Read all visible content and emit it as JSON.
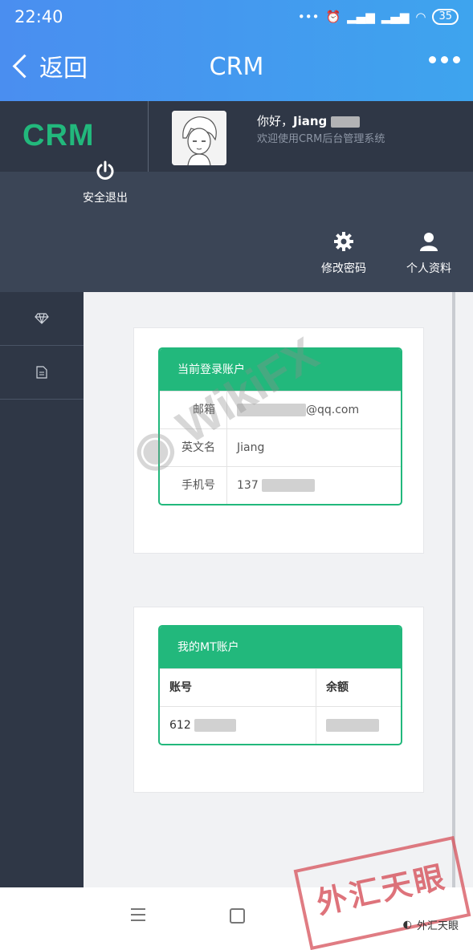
{
  "status": {
    "time": "22:40",
    "battery": "35"
  },
  "titlebar": {
    "back_label": "返回",
    "title": "CRM"
  },
  "header": {
    "logo": "CRM",
    "greeting": "你好，",
    "username": "Jiang",
    "welcome": "欢迎使用CRM后台管理系统",
    "logout_label": "安全退出",
    "change_password_label": "修改密码",
    "profile_label": "个人资料"
  },
  "account": {
    "title": "当前登录账户",
    "rows": [
      {
        "label": "邮箱",
        "value": "@qq.com"
      },
      {
        "label": "英文名",
        "value": "Jiang"
      },
      {
        "label": "手机号",
        "value": "137"
      }
    ]
  },
  "mt": {
    "title": "我的MT账户",
    "columns": [
      "账号",
      "余额"
    ],
    "rows": [
      {
        "account": "612"
      }
    ]
  },
  "watermark": {
    "text": "WikiFX",
    "stamp": "外汇天眼",
    "wechat_label": "外汇天眼"
  },
  "colors": {
    "accent": "#22b87c",
    "header_blue": "#4a8ef0",
    "dark": "#2f3746"
  }
}
